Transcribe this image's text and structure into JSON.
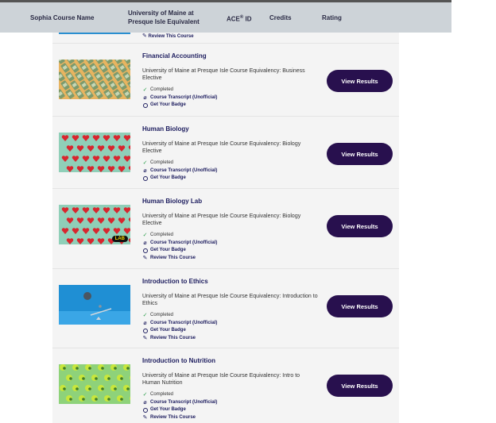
{
  "table_header": {
    "course_name": "Sophia Course Name",
    "equivalent": "University of Maine at Presque Isle Equivalent",
    "ace_id": "ACE",
    "ace_sup": "®",
    "ace_suffix": " ID",
    "credits": "Credits",
    "rating": "Rating"
  },
  "top_stub": {
    "review_label": "Review This Course"
  },
  "courses": [
    {
      "title": "Financial Accounting",
      "description": "University of Maine at Presque Isle Course Equivalency: Business Elective",
      "completed": "Completed",
      "transcript": "Course Transcript (Unofficial)",
      "badge": "Get Your Badge",
      "review": "",
      "button": "View Results",
      "thumb": "money"
    },
    {
      "title": "Human Biology",
      "description": "University of Maine at Presque Isle Course Equivalency: Biology Elective",
      "completed": "Completed",
      "transcript": "Course Transcript (Unofficial)",
      "badge": "Get Your Badge",
      "review": "",
      "button": "View Results",
      "thumb": "hearts"
    },
    {
      "title": "Human Biology Lab",
      "description": "University of Maine at Presque Isle Course Equivalency: Biology Elective",
      "completed": "Completed",
      "transcript": "Course Transcript (Unofficial)",
      "badge": "Get Your Badge",
      "review": "Review This Course",
      "button": "View Results",
      "thumb": "hearts",
      "thumb_badge": "LAB"
    },
    {
      "title": "Introduction to Ethics",
      "description": "University of Maine at Presque Isle Course Equivalency: Introduction to Ethics",
      "completed": "Completed",
      "transcript": "Course Transcript (Unofficial)",
      "badge": "Get Your Badge",
      "review": "Review This Course",
      "button": "View Results",
      "thumb": "scale"
    },
    {
      "title": "Introduction to Nutrition",
      "description": "University of Maine at Presque Isle Course Equivalency: Intro to Human Nutrition",
      "completed": "Completed",
      "transcript": "Course Transcript (Unofficial)",
      "badge": "Get Your Badge",
      "review": "Review This Course",
      "button": "View Results",
      "thumb": "apples"
    }
  ],
  "colors": {
    "header_bg": "#cdd3d8",
    "title_text": "#1c1c5e",
    "button_bg": "#28104e",
    "check_green": "#2c9e4b"
  }
}
